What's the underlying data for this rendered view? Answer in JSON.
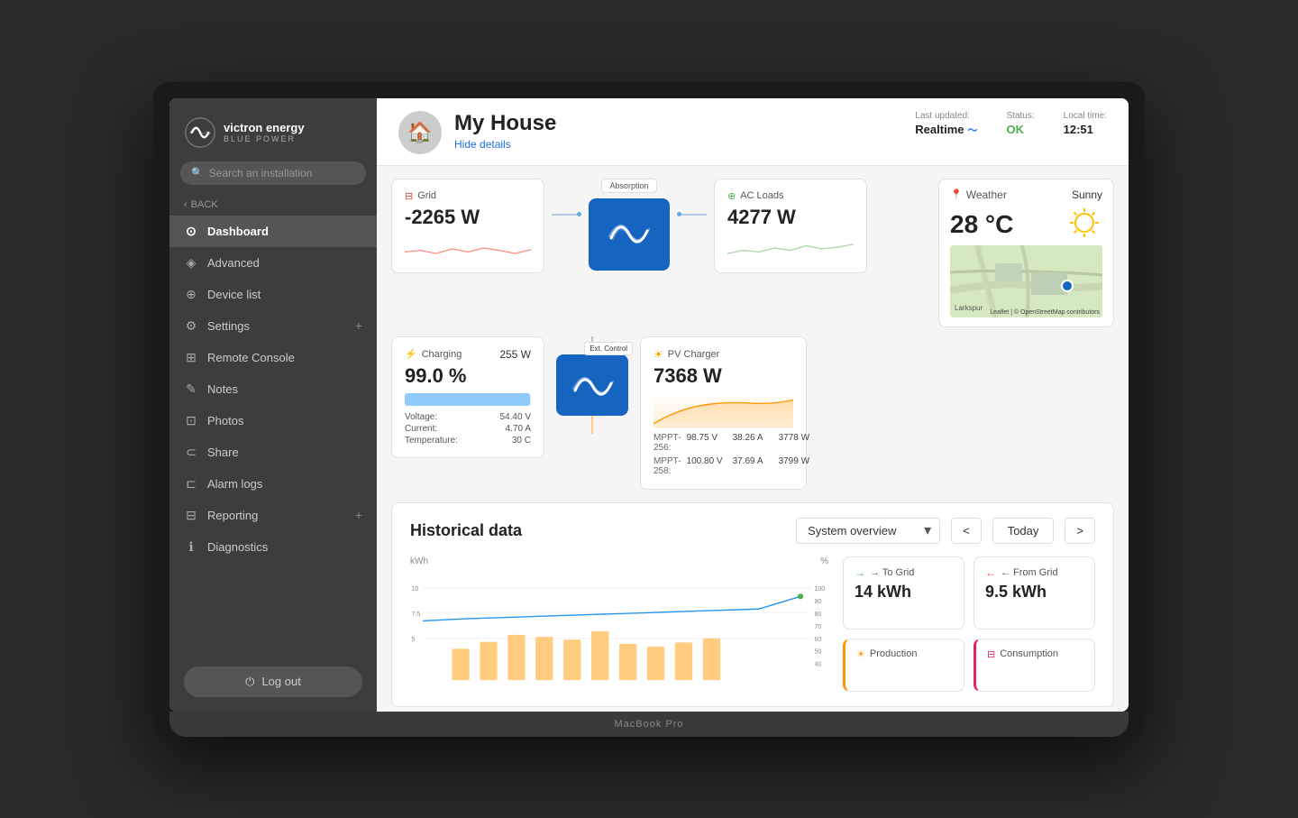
{
  "laptop": {
    "model": "MacBook Pro"
  },
  "sidebar": {
    "logo_brand": "victron energy",
    "logo_sub": "BLUE POWER",
    "search_placeholder": "Search an installation",
    "back_label": "BACK",
    "nav_items": [
      {
        "id": "dashboard",
        "label": "Dashboard",
        "icon": "⊙",
        "active": true
      },
      {
        "id": "advanced",
        "label": "Advanced",
        "icon": "◈",
        "active": false
      },
      {
        "id": "device-list",
        "label": "Device list",
        "icon": "⊕",
        "active": false
      },
      {
        "id": "settings",
        "label": "Settings",
        "icon": "⚙",
        "active": false,
        "expandable": true
      },
      {
        "id": "remote-console",
        "label": "Remote Console",
        "icon": "⊞",
        "active": false
      },
      {
        "id": "notes",
        "label": "Notes",
        "icon": "✎",
        "active": false
      },
      {
        "id": "photos",
        "label": "Photos",
        "icon": "⊡",
        "active": false
      },
      {
        "id": "share",
        "label": "Share",
        "icon": "⊂",
        "active": false
      },
      {
        "id": "alarm-logs",
        "label": "Alarm logs",
        "icon": "⊏",
        "active": false
      },
      {
        "id": "reporting",
        "label": "Reporting",
        "icon": "⊟",
        "active": false,
        "expandable": true
      },
      {
        "id": "diagnostics",
        "label": "Diagnostics",
        "icon": "ℹ",
        "active": false
      }
    ],
    "logout_label": "Log out"
  },
  "header": {
    "house_name": "My House",
    "hide_details": "Hide details",
    "last_updated_label": "Last updated:",
    "last_updated_val": "Realtime",
    "status_label": "Status:",
    "status_val": "OK",
    "local_time_label": "Local time:",
    "local_time_val": "12:51"
  },
  "grid_card": {
    "title": "Grid",
    "value": "-2265 W"
  },
  "charging_card": {
    "title": "Charging",
    "watts": "255 W",
    "percentage": "99.0 %",
    "fill_pct": 99,
    "voltage_label": "Voltage:",
    "voltage_val": "54.40 V",
    "current_label": "Current:",
    "current_val": "4.70 A",
    "temperature_label": "Temperature:",
    "temperature_val": "30 C"
  },
  "inverter": {
    "absorption_label": "Absorption",
    "ext_control_label": "Ext. Control"
  },
  "ac_loads_card": {
    "title": "AC Loads",
    "value": "4277 W"
  },
  "pv_charger_card": {
    "title": "PV Charger",
    "value": "7368 W",
    "mppt_256_label": "MPPT-256:",
    "mppt_256_v": "98.75 V",
    "mppt_256_a": "38.26 A",
    "mppt_256_w": "3778 W",
    "mppt_258_label": "MPPT-258:",
    "mppt_258_v": "100.80 V",
    "mppt_258_a": "37.69 A",
    "mppt_258_w": "3799 W"
  },
  "weather_card": {
    "title": "Weather",
    "condition": "Sunny",
    "temp": "28 °C",
    "map_label": "Larkspur",
    "leaflet_credit": "Leaflet | © OpenStreetMap contributors"
  },
  "historical": {
    "title": "Historical data",
    "system_overview": "System overview",
    "today_label": "Today",
    "chart_y_label": "kWh",
    "chart_y_right_label": "%",
    "to_grid_label": "→ To Grid",
    "to_grid_value": "14 kWh",
    "from_grid_label": "← From Grid",
    "from_grid_value": "9.5 kWh",
    "production_label": "Production",
    "consumption_label": "Consumption"
  }
}
